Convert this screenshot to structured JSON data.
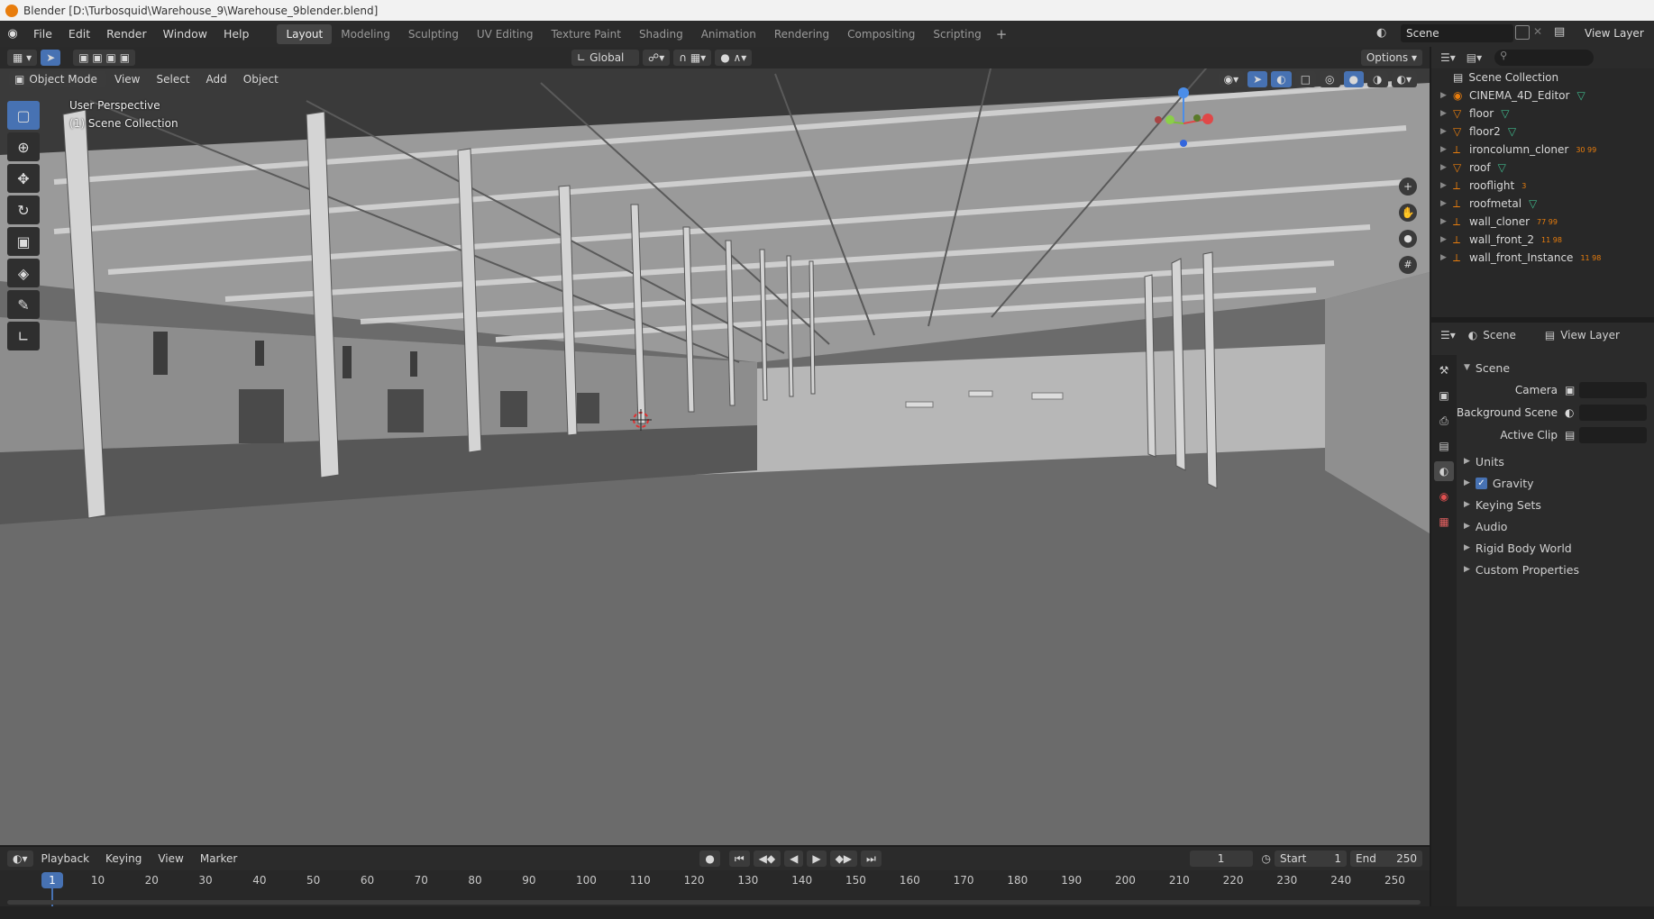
{
  "window": {
    "title": "Blender [D:\\Turbosquid\\Warehouse_9\\Warehouse_9blender.blend]"
  },
  "menu": [
    "File",
    "Edit",
    "Render",
    "Window",
    "Help"
  ],
  "workspaces": [
    "Layout",
    "Modeling",
    "Sculpting",
    "UV Editing",
    "Texture Paint",
    "Shading",
    "Animation",
    "Rendering",
    "Compositing",
    "Scripting"
  ],
  "active_workspace": "Layout",
  "scene_selector": "Scene",
  "view_layer_selector": "View Layer",
  "viewport": {
    "transform_orientation": "Global",
    "options_label": "Options",
    "mode": "Object Mode",
    "menus": [
      "View",
      "Select",
      "Add",
      "Object"
    ],
    "overlay_line1": "User Perspective",
    "overlay_line2": "(1) Scene Collection"
  },
  "outliner": {
    "root": "Scene Collection",
    "items": [
      {
        "name": "CINEMA_4D_Editor",
        "type": "camera",
        "extra": ""
      },
      {
        "name": "floor",
        "type": "mesh",
        "extra": ""
      },
      {
        "name": "floor2",
        "type": "mesh",
        "extra": ""
      },
      {
        "name": "ironcolumn_cloner",
        "type": "empty",
        "extra": "30 99"
      },
      {
        "name": "roof",
        "type": "mesh",
        "extra": ""
      },
      {
        "name": "rooflight",
        "type": "empty",
        "extra": "3"
      },
      {
        "name": "roofmetal",
        "type": "empty",
        "extra": ""
      },
      {
        "name": "wall_cloner",
        "type": "empty",
        "extra": "77 99"
      },
      {
        "name": "wall_front_2",
        "type": "empty",
        "extra": "11 98"
      },
      {
        "name": "wall_front_Instance",
        "type": "empty",
        "extra": "11 98"
      }
    ]
  },
  "properties": {
    "tab_scene": "Scene",
    "tab_view_layer": "View Layer",
    "panel": "Scene",
    "fields": [
      {
        "label": "Camera"
      },
      {
        "label": "Background Scene"
      },
      {
        "label": "Active Clip"
      }
    ],
    "subpanels": [
      "Units",
      "Gravity",
      "Keying Sets",
      "Audio",
      "Rigid Body World",
      "Custom Properties"
    ],
    "gravity_checked": true
  },
  "timeline": {
    "menus": [
      "Playback",
      "Keying",
      "View",
      "Marker"
    ],
    "current_frame": "1",
    "start_label": "Start",
    "start_value": "1",
    "end_label": "End",
    "end_value": "250",
    "ruler": [
      "1",
      "10",
      "20",
      "30",
      "40",
      "50",
      "60",
      "70",
      "80",
      "90",
      "100",
      "110",
      "120",
      "130",
      "140",
      "150",
      "160",
      "170",
      "180",
      "190",
      "200",
      "210",
      "220",
      "230",
      "240",
      "250"
    ]
  },
  "colors": {
    "accent": "#4772b3",
    "orange": "#e87d0d",
    "mesh_green": "#3fb58a"
  }
}
